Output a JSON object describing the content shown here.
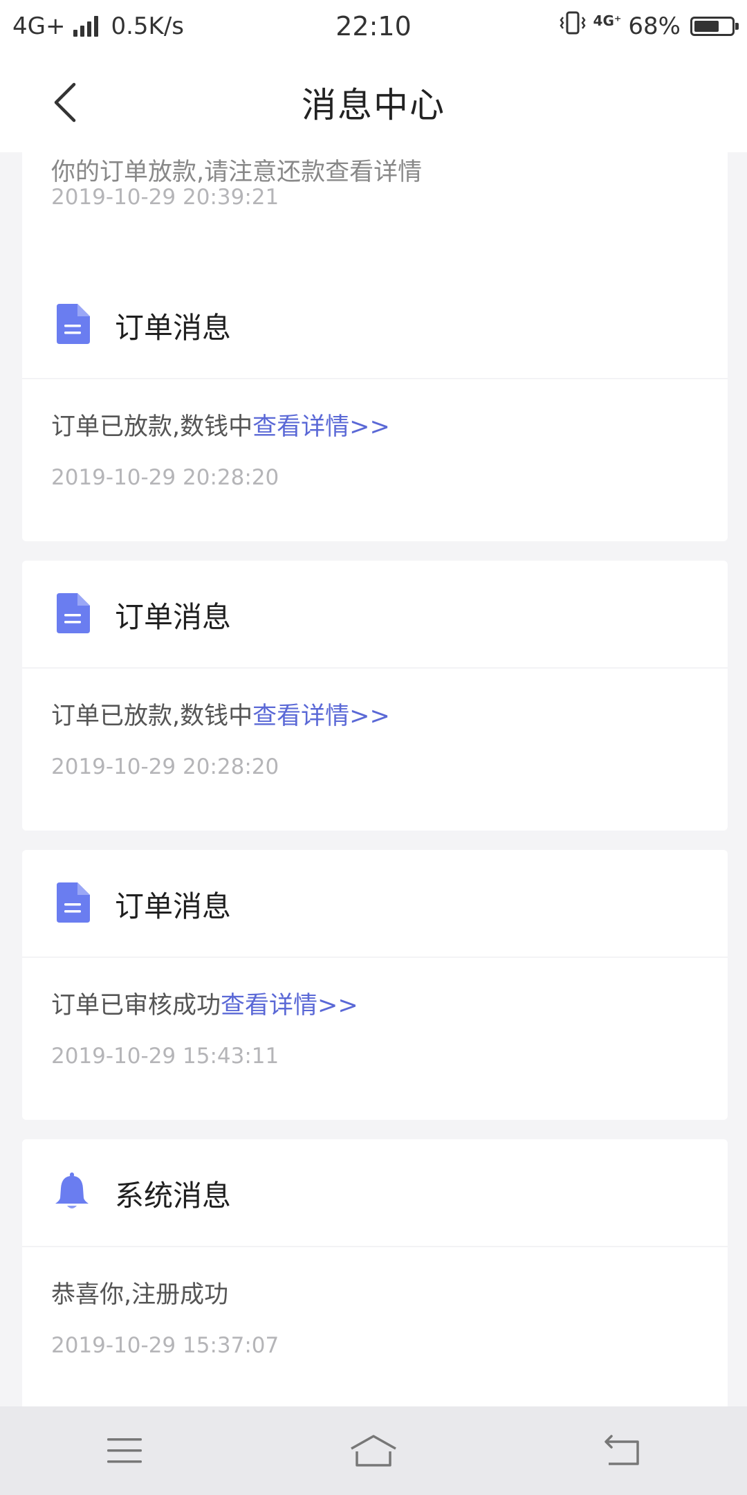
{
  "status_bar": {
    "network": "4G+",
    "speed": "0.5K/s",
    "time": "22:10",
    "network_small": "4G⁺",
    "battery": "68%",
    "battery_level": 0.68
  },
  "header": {
    "title": "消息中心"
  },
  "partial_card": {
    "text_cut": "你的订单放款,请注意还款查看详情",
    "time": "2019-10-29 20:39:21"
  },
  "messages": [
    {
      "type": "订单消息",
      "text": "订单已放款,数钱中",
      "link": "查看详情>>",
      "time": "2019-10-29 20:28:20"
    },
    {
      "type": "订单消息",
      "text": "订单已放款,数钱中",
      "link": "查看详情>>",
      "time": "2019-10-29 20:28:20"
    },
    {
      "type": "订单消息",
      "text": "订单已审核成功",
      "link": "查看详情>>",
      "time": "2019-10-29 15:43:11"
    },
    {
      "type": "系统消息",
      "text": "恭喜你,注册成功",
      "link": "",
      "time": "2019-10-29 15:37:07"
    }
  ],
  "icons": {
    "back": "back-arrow-icon",
    "order": "document-icon",
    "system": "bell-icon",
    "menu": "menu-icon",
    "home": "home-icon",
    "return": "return-icon"
  },
  "colors": {
    "accent": "#5a68d6",
    "icon": "#6a7df0",
    "time_text": "#b5b5b8",
    "background": "#f4f4f6"
  }
}
